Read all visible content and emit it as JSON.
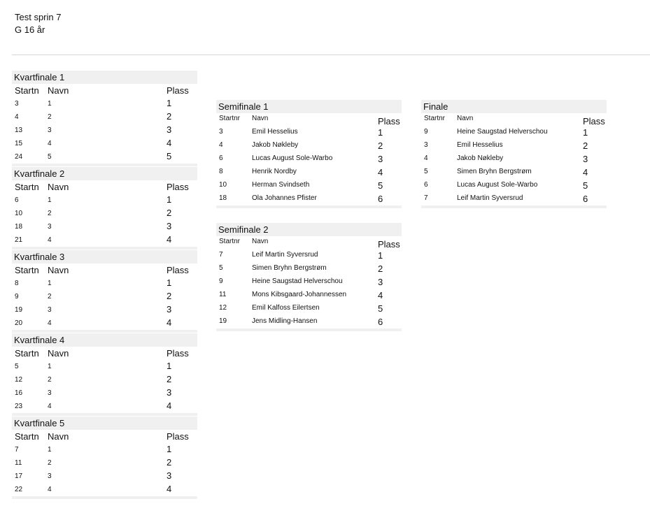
{
  "header": {
    "title": "Test sprin 7",
    "subtitle": "G 16 år"
  },
  "quarterfinals": [
    {
      "title": "Kvartfinale 1",
      "col_start": "Startn",
      "col_name": "Navn",
      "col_place": "Plass",
      "rows": [
        [
          "3",
          "1",
          "1"
        ],
        [
          "4",
          "2",
          "2"
        ],
        [
          "13",
          "3",
          "3"
        ],
        [
          "15",
          "4",
          "4"
        ],
        [
          "24",
          "5",
          "5"
        ]
      ]
    },
    {
      "title": "Kvartfinale 2",
      "col_start": "Startn",
      "col_name": "Navn",
      "col_place": "Plass",
      "rows": [
        [
          "6",
          "1",
          "1"
        ],
        [
          "10",
          "2",
          "2"
        ],
        [
          "18",
          "3",
          "3"
        ],
        [
          "21",
          "4",
          "4"
        ]
      ]
    },
    {
      "title": "Kvartfinale 3",
      "col_start": "Startn",
      "col_name": "Navn",
      "col_place": "Plass",
      "rows": [
        [
          "8",
          "1",
          "1"
        ],
        [
          "9",
          "2",
          "2"
        ],
        [
          "19",
          "3",
          "3"
        ],
        [
          "20",
          "4",
          "4"
        ]
      ]
    },
    {
      "title": "Kvartfinale 4",
      "col_start": "Startn",
      "col_name": "Navn",
      "col_place": "Plass",
      "rows": [
        [
          "5",
          "1",
          "1"
        ],
        [
          "12",
          "2",
          "2"
        ],
        [
          "16",
          "3",
          "3"
        ],
        [
          "23",
          "4",
          "4"
        ]
      ]
    },
    {
      "title": "Kvartfinale 5",
      "col_start": "Startn",
      "col_name": "Navn",
      "col_place": "Plass",
      "rows": [
        [
          "7",
          "1",
          "1"
        ],
        [
          "11",
          "2",
          "2"
        ],
        [
          "17",
          "3",
          "3"
        ],
        [
          "22",
          "4",
          "4"
        ]
      ]
    }
  ],
  "semifinals": [
    {
      "title": "Semifinale 1",
      "col_start": "Startnr",
      "col_name": "Navn",
      "col_place": "Plass",
      "rows": [
        [
          "3",
          "Emil Hesselius",
          "1"
        ],
        [
          "4",
          "Jakob Nøkleby",
          "2"
        ],
        [
          "6",
          "Lucas August Sole-Warbo",
          "3"
        ],
        [
          "8",
          "Henrik Nordby",
          "4"
        ],
        [
          "10",
          "Herman Svindseth",
          "5"
        ],
        [
          "18",
          "Ola Johannes Pfister",
          "6"
        ]
      ]
    },
    {
      "title": "Semifinale 2",
      "col_start": "Startnr",
      "col_name": "Navn",
      "col_place": "Plass",
      "rows": [
        [
          "7",
          "Leif Martin Syversrud",
          "1"
        ],
        [
          "5",
          "Simen Bryhn Bergstrøm",
          "2"
        ],
        [
          "9",
          "Heine Saugstad Helverschou",
          "3"
        ],
        [
          "11",
          "Mons Kibsgaard-Johannessen",
          "4"
        ],
        [
          "12",
          "Emil Kalfoss Eilertsen",
          "5"
        ],
        [
          "19",
          "Jens Midling-Hansen",
          "6"
        ]
      ]
    }
  ],
  "final": {
    "title": "Finale",
    "col_start": "Startnr",
    "col_name": "Navn",
    "col_place": "Plass",
    "rows": [
      [
        "9",
        "Heine Saugstad Helverschou",
        "1"
      ],
      [
        "3",
        "Emil Hesselius",
        "2"
      ],
      [
        "4",
        "Jakob Nøkleby",
        "3"
      ],
      [
        "5",
        "Simen Bryhn Bergstrøm",
        "4"
      ],
      [
        "6",
        "Lucas August Sole-Warbo",
        "5"
      ],
      [
        "7",
        "Leif Martin Syversrud",
        "6"
      ]
    ]
  }
}
